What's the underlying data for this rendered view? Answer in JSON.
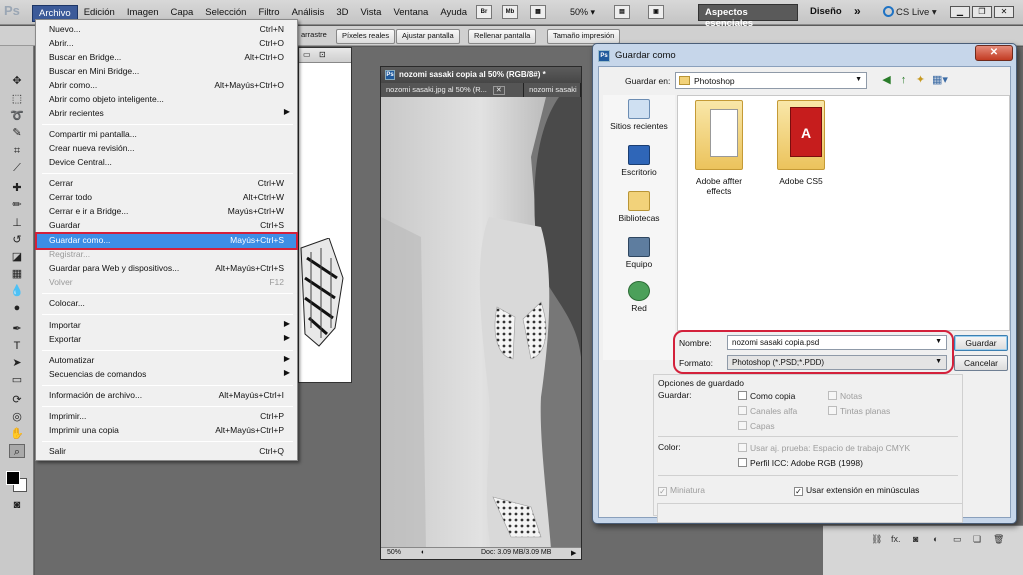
{
  "app": {
    "logo": "Ps"
  },
  "menubar": {
    "items": [
      "Archivo",
      "Edición",
      "Imagen",
      "Capa",
      "Selección",
      "Filtro",
      "Análisis",
      "3D",
      "Vista",
      "Ventana",
      "Ayuda"
    ],
    "zoom": "50%",
    "workspace_active": "Aspectos esenciales",
    "workspace_other": "Diseño",
    "more": "»",
    "cslive": "CS Live"
  },
  "optionsbar": {
    "buttons": [
      "arrastre",
      "Píxeles reales",
      "Ajustar pantalla",
      "Rellenar pantalla",
      "Tamaño impresión"
    ]
  },
  "file_menu": {
    "items": [
      {
        "label": "Nuevo...",
        "shortcut": "Ctrl+N"
      },
      {
        "label": "Abrir...",
        "shortcut": "Ctrl+O"
      },
      {
        "label": "Buscar en Bridge...",
        "shortcut": "Alt+Ctrl+O"
      },
      {
        "label": "Buscar en Mini Bridge...",
        "shortcut": ""
      },
      {
        "label": "Abrir como...",
        "shortcut": "Alt+Mayús+Ctrl+O"
      },
      {
        "label": "Abrir como objeto inteligente...",
        "shortcut": ""
      },
      {
        "label": "Abrir recientes",
        "shortcut": "",
        "submenu": true
      },
      {
        "label": "Compartir mi pantalla...",
        "shortcut": ""
      },
      {
        "label": "Crear nueva revisión...",
        "shortcut": ""
      },
      {
        "label": "Device Central...",
        "shortcut": ""
      },
      {
        "label": "Cerrar",
        "shortcut": "Ctrl+W"
      },
      {
        "label": "Cerrar todo",
        "shortcut": "Alt+Ctrl+W"
      },
      {
        "label": "Cerrar e ir a Bridge...",
        "shortcut": "Mayús+Ctrl+W"
      },
      {
        "label": "Guardar",
        "shortcut": "Ctrl+S"
      },
      {
        "label": "Guardar como...",
        "shortcut": "Mayús+Ctrl+S",
        "highlighted": true
      },
      {
        "label": "Registrar...",
        "shortcut": "",
        "disabled": true
      },
      {
        "label": "Guardar para Web y dispositivos...",
        "shortcut": "Alt+Mayús+Ctrl+S"
      },
      {
        "label": "Volver",
        "shortcut": "F12",
        "disabled": true
      },
      {
        "label": "Colocar...",
        "shortcut": ""
      },
      {
        "label": "Importar",
        "shortcut": "",
        "submenu": true
      },
      {
        "label": "Exportar",
        "shortcut": "",
        "submenu": true
      },
      {
        "label": "Automatizar",
        "shortcut": "",
        "submenu": true
      },
      {
        "label": "Secuencias de comandos",
        "shortcut": "",
        "submenu": true
      },
      {
        "label": "Información de archivo...",
        "shortcut": "Alt+Mayús+Ctrl+I"
      },
      {
        "label": "Imprimir...",
        "shortcut": "Ctrl+P"
      },
      {
        "label": "Imprimir una copia",
        "shortcut": "Alt+Mayús+Ctrl+P"
      },
      {
        "label": "Salir",
        "shortcut": "Ctrl+Q"
      }
    ]
  },
  "document": {
    "title": "nozomi sasaki copia al 50% (RGB/8#) *",
    "tabs": [
      "nozomi sasaki.jpg al 50% (R...",
      "nozomi sasaki"
    ],
    "zoom": "50%",
    "doc_info": "Doc: 3.09 MB/3.09 MB"
  },
  "dialog": {
    "title": "Guardar como",
    "close": "✕",
    "look_in_label": "Guardar en:",
    "look_in_value": "Photoshop",
    "places": [
      "Sitios recientes",
      "Escritorio",
      "Bibliotecas",
      "Equipo",
      "Red"
    ],
    "files": [
      "Adobe affter effects",
      "Adobe CS5"
    ],
    "name_label": "Nombre:",
    "name_value": "nozomi sasaki copia.psd",
    "format_label": "Formato:",
    "format_value": "Photoshop (*.PSD;*.PDD)",
    "save_button": "Guardar",
    "cancel_button": "Cancelar",
    "options": {
      "title": "Opciones de guardado",
      "save_label": "Guardar:",
      "as_copy": "Como copia",
      "notes": "Notas",
      "alpha": "Canales alfa",
      "spot": "Tintas planas",
      "layers": "Capas",
      "color_label": "Color:",
      "proof": "Usar aj. prueba: Espacio de trabajo CMYK",
      "icc": "Perfil ICC: Adobe RGB (1998)",
      "thumbnail": "Miniatura",
      "lowercase": "Usar extensión en minúsculas"
    }
  }
}
